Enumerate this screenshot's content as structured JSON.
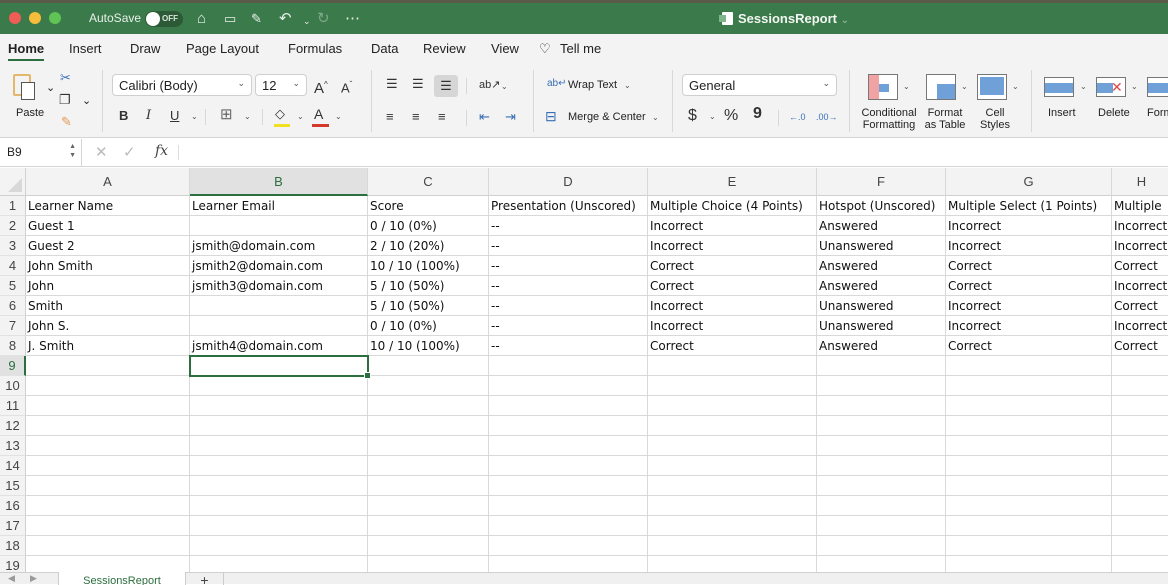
{
  "titlebar": {
    "autosave_label": "AutoSave",
    "autosave_state": "OFF",
    "document_title": "SessionsReport",
    "quick_access": [
      "home-icon",
      "save-icon",
      "save-as-icon",
      "undo-icon",
      "redo-icon",
      "more-icon"
    ]
  },
  "ribbon_tabs": [
    {
      "label": "Home",
      "active": true
    },
    {
      "label": "Insert"
    },
    {
      "label": "Draw"
    },
    {
      "label": "Page Layout"
    },
    {
      "label": "Formulas"
    },
    {
      "label": "Data"
    },
    {
      "label": "Review"
    },
    {
      "label": "View"
    }
  ],
  "tell_me": "Tell me",
  "ribbon": {
    "paste_label": "Paste",
    "font_name": "Calibri (Body)",
    "font_size": "12",
    "bold": "B",
    "italic": "I",
    "underline": "U",
    "wrap_text": "Wrap Text",
    "merge_center": "Merge & Center",
    "number_format": "General",
    "currency": "$",
    "percent": "%",
    "comma": "9",
    "conditional_formatting": [
      "Conditional",
      "Formatting"
    ],
    "format_as_table": [
      "Format",
      "as Table"
    ],
    "cell_styles": [
      "Cell",
      "Styles"
    ],
    "insert": "Insert",
    "delete": "Delete",
    "format": "Form"
  },
  "formula_bar": {
    "name_box": "B9",
    "fx": "fx",
    "formula": ""
  },
  "sheet": {
    "columns": [
      "A",
      "B",
      "C",
      "D",
      "E",
      "F",
      "G",
      "H"
    ],
    "selected_column": "B",
    "selected_row": 9,
    "selected_cell": "B9",
    "row_numbers": [
      1,
      2,
      3,
      4,
      5,
      6,
      7,
      8,
      9,
      10,
      11,
      12,
      13,
      14,
      15,
      16,
      17,
      18,
      19
    ],
    "rows": [
      [
        "Learner Name",
        "Learner Email",
        "Score",
        "Presentation (Unscored)",
        "Multiple Choice (4 Points)",
        "Hotspot (Unscored)",
        "Multiple Select (1 Points)",
        "Multiple"
      ],
      [
        "Guest 1",
        "",
        "0 / 10 (0%)",
        "--",
        "Incorrect",
        "Answered",
        "Incorrect",
        "Incorrect"
      ],
      [
        "Guest 2",
        "jsmith@domain.com",
        "2 / 10 (20%)",
        "--",
        "Incorrect",
        "Unanswered",
        "Incorrect",
        "Incorrect"
      ],
      [
        "John Smith",
        "jsmith2@domain.com",
        "10 / 10 (100%)",
        "--",
        "Correct",
        "Answered",
        "Correct",
        "Correct"
      ],
      [
        "John",
        "jsmith3@domain.com",
        "5 / 10 (50%)",
        "--",
        "Correct",
        "Answered",
        "Correct",
        "Incorrect"
      ],
      [
        "Smith",
        "",
        "5 / 10 (50%)",
        "--",
        "Incorrect",
        "Unanswered",
        "Incorrect",
        "Correct"
      ],
      [
        "John S.",
        "",
        "0 / 10 (0%)",
        "--",
        "Incorrect",
        "Unanswered",
        "Incorrect",
        "Incorrect"
      ],
      [
        "J. Smith",
        "jsmith4@domain.com",
        "10 / 10 (100%)",
        "--",
        "Correct",
        "Answered",
        "Correct",
        "Correct"
      ]
    ]
  },
  "sheet_tabs": [
    {
      "label": "SessionsReport",
      "active": true
    }
  ],
  "add_sheet": "+",
  "colors": {
    "accent": "#3b7a4a",
    "selection": "#2b6e3f"
  }
}
